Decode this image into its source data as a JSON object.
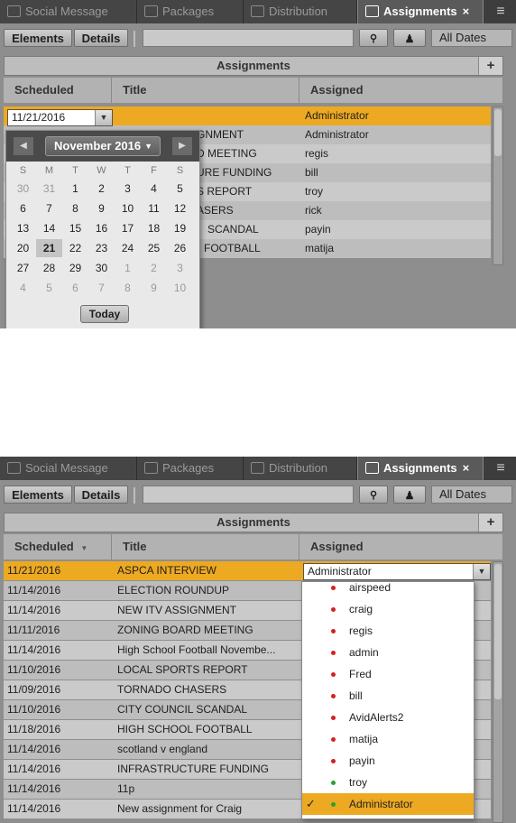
{
  "tabs": [
    {
      "label": "Social Message"
    },
    {
      "label": "Packages"
    },
    {
      "label": "Distribution"
    },
    {
      "label": "Assignments",
      "close": "×"
    }
  ],
  "menu_icon": "≡",
  "toolbar": {
    "elements_label": "Elements",
    "details_label": "Details",
    "dates_label": "All Dates",
    "search_icon": "search-icon",
    "person_icon": "person-icon"
  },
  "section": {
    "title": "Assignments",
    "add_label": "+"
  },
  "columns": {
    "scheduled": "Scheduled",
    "title": "Title",
    "assigned": "Assigned",
    "sort_arrow": "▼"
  },
  "top": {
    "date_value": "11/21/2016",
    "caret": "▼",
    "rows": [
      {
        "title": "",
        "assigned": "Administrator"
      },
      {
        "title": "GNMENT",
        "assigned": "Administrator"
      },
      {
        "title": "D MEETING",
        "assigned": "regis"
      },
      {
        "title": "URE FUNDING",
        "assigned": "bill"
      },
      {
        "title": "S REPORT",
        "assigned": "troy"
      },
      {
        "title": "ASERS",
        "assigned": "rick"
      },
      {
        "title": "SCANDAL",
        "assigned": "payin"
      },
      {
        "title": "FOOTBALL",
        "assigned": "matija"
      }
    ],
    "calendar": {
      "month": "November 2016",
      "prev": "◀",
      "next": "▶",
      "dow": [
        "S",
        "M",
        "T",
        "W",
        "T",
        "F",
        "S"
      ],
      "weeks": [
        [
          "30",
          "31",
          "1",
          "2",
          "3",
          "4",
          "5"
        ],
        [
          "6",
          "7",
          "8",
          "9",
          "10",
          "11",
          "12"
        ],
        [
          "13",
          "14",
          "15",
          "16",
          "17",
          "18",
          "19"
        ],
        [
          "20",
          "21",
          "22",
          "23",
          "24",
          "25",
          "26"
        ],
        [
          "27",
          "28",
          "29",
          "30",
          "1",
          "2",
          "3"
        ],
        [
          "4",
          "5",
          "6",
          "7",
          "8",
          "9",
          "10"
        ]
      ],
      "today_day": "21",
      "today_label": "Today"
    }
  },
  "bottom": {
    "rows": [
      {
        "date": "11/21/2016",
        "title": "ASPCA INTERVIEW",
        "assigned": "Administrator"
      },
      {
        "date": "11/14/2016",
        "title": "ELECTION ROUNDUP",
        "assigned": ""
      },
      {
        "date": "11/14/2016",
        "title": "NEW ITV ASSIGNMENT",
        "assigned": ""
      },
      {
        "date": "11/11/2016",
        "title": "ZONING BOARD MEETING",
        "assigned": ""
      },
      {
        "date": "11/14/2016",
        "title": "High School Football Novembe...",
        "assigned": ""
      },
      {
        "date": "11/10/2016",
        "title": "LOCAL SPORTS REPORT",
        "assigned": ""
      },
      {
        "date": "11/09/2016",
        "title": "TORNADO CHASERS",
        "assigned": ""
      },
      {
        "date": "11/10/2016",
        "title": "CITY COUNCIL SCANDAL",
        "assigned": ""
      },
      {
        "date": "11/18/2016",
        "title": "HIGH SCHOOL FOOTBALL",
        "assigned": ""
      },
      {
        "date": "11/14/2016",
        "title": "scotland v england",
        "assigned": ""
      },
      {
        "date": "11/14/2016",
        "title": "INFRASTRUCTURE FUNDING",
        "assigned": ""
      },
      {
        "date": "11/14/2016",
        "title": "11p",
        "assigned": ""
      },
      {
        "date": "11/14/2016",
        "title": "New assignment for Craig",
        "assigned": ""
      }
    ],
    "assigned_value": "Administrator",
    "caret": "▼",
    "options": [
      {
        "label": "airspeed",
        "status": "red"
      },
      {
        "label": "craig",
        "status": "red"
      },
      {
        "label": "regis",
        "status": "red"
      },
      {
        "label": "admin",
        "status": "red"
      },
      {
        "label": "Fred",
        "status": "red"
      },
      {
        "label": "bill",
        "status": "red"
      },
      {
        "label": "AvidAlerts2",
        "status": "red"
      },
      {
        "label": "matija",
        "status": "red"
      },
      {
        "label": "payin",
        "status": "red"
      },
      {
        "label": "troy",
        "status": "green"
      },
      {
        "label": "Administrator",
        "status": "green",
        "selected": true,
        "check": "✓"
      }
    ]
  },
  "colors": {
    "selected": "#eda921",
    "red": "#d42020",
    "green": "#2e9e2e"
  }
}
